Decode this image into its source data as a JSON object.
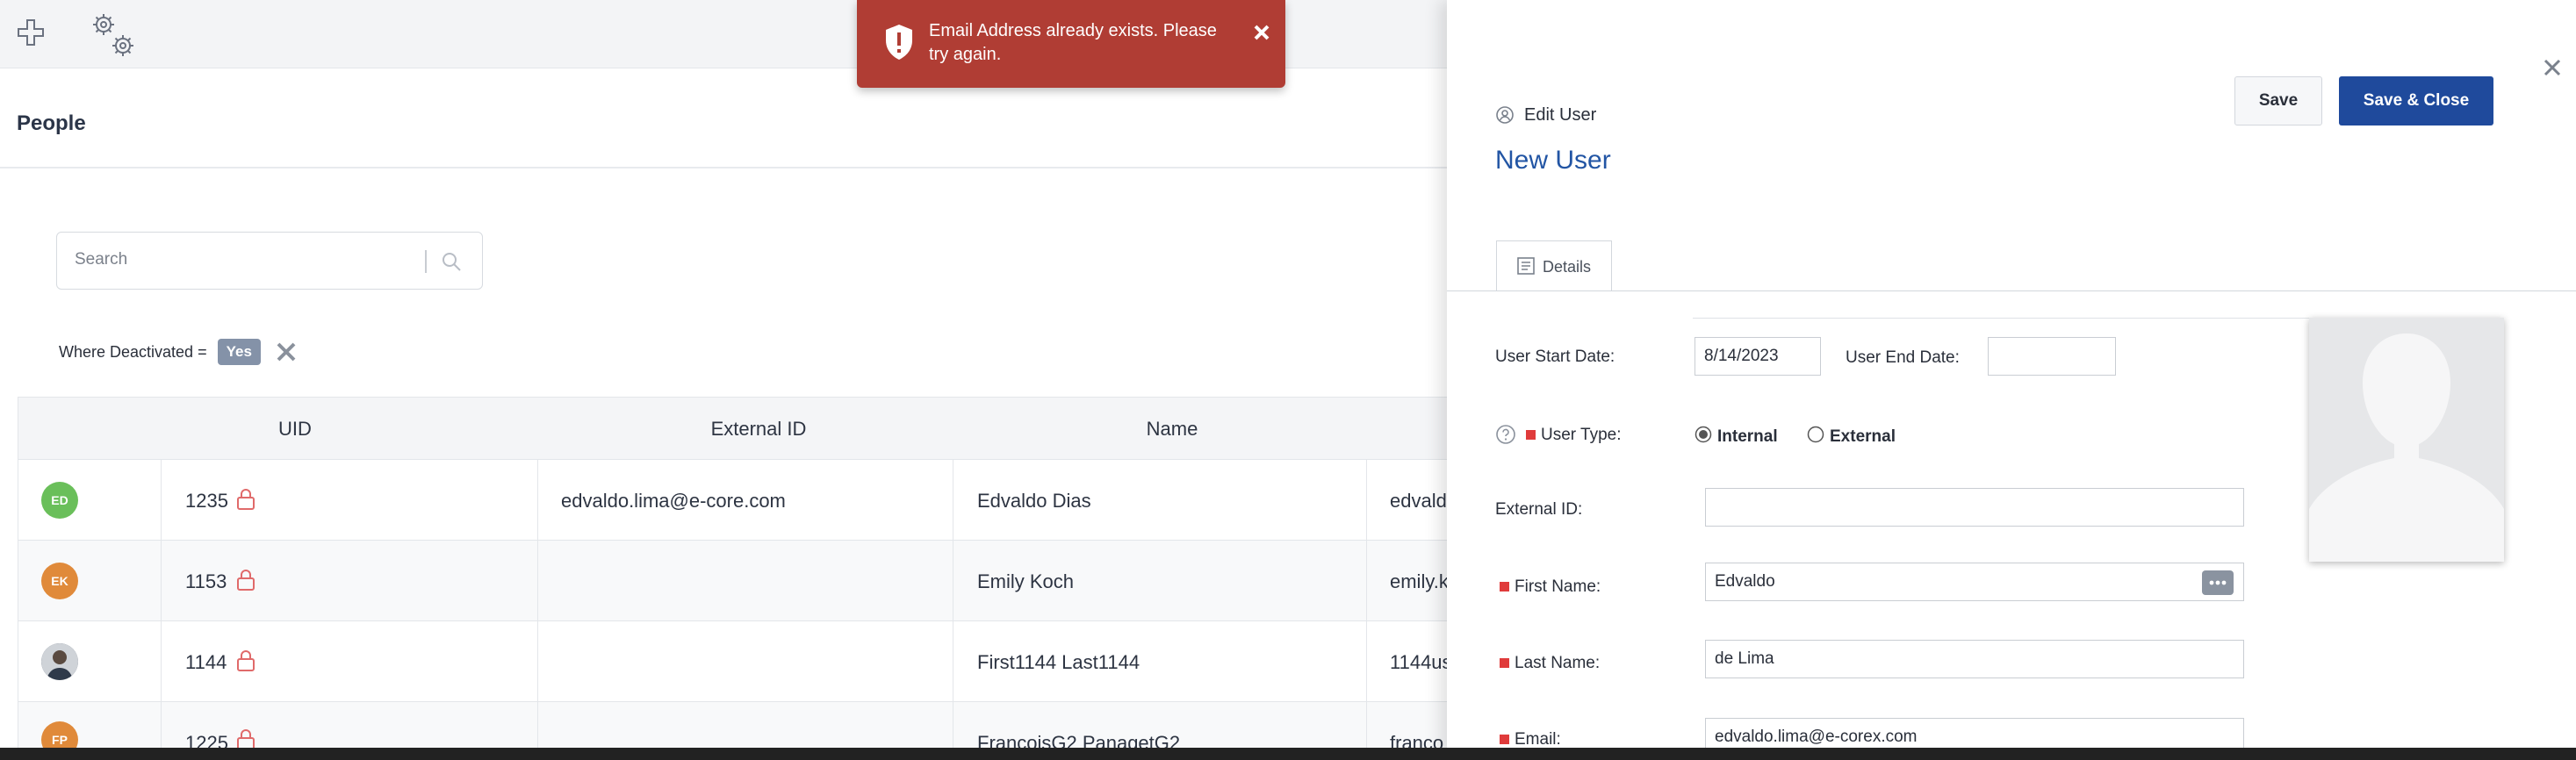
{
  "app": {
    "page_title": "People"
  },
  "search": {
    "placeholder": "Search"
  },
  "filter": {
    "label": "Where Deactivated =",
    "value": "Yes"
  },
  "table": {
    "columns": [
      "UID",
      "External ID",
      "Name"
    ],
    "rows": [
      {
        "initials": "ED",
        "avatar_color": "#6abf5a",
        "uid": "1235",
        "external_id": "edvaldo.lima@e-core.com",
        "name": "Edvaldo Dias",
        "extra": "edvald"
      },
      {
        "initials": "EK",
        "avatar_color": "#e08a3a",
        "uid": "1153",
        "external_id": "",
        "name": "Emily Koch",
        "extra": "emily.k"
      },
      {
        "initials": "",
        "avatar_color": "#4a5568",
        "uid": "1144",
        "external_id": "",
        "name": "First1144 Last1144",
        "extra": "1144us"
      },
      {
        "initials": "FP",
        "avatar_color": "#e08a3a",
        "uid": "1225",
        "external_id": "",
        "name": "FrancoisG2 PanagetG2",
        "extra": "franco"
      }
    ]
  },
  "toast": {
    "message": "Email Address already exists. Please try again."
  },
  "panel": {
    "header_label": "Edit User",
    "title": "New User",
    "save_label": "Save",
    "save_close_label": "Save & Close",
    "tab_details": "Details",
    "fields": {
      "start_date_label": "User Start Date:",
      "start_date_value": "8/14/2023",
      "end_date_label": "User End Date:",
      "end_date_value": "",
      "user_type_label": "User Type:",
      "user_type_internal": "Internal",
      "user_type_external": "External",
      "user_type_selected": "Internal",
      "external_id_label": "External ID:",
      "external_id_value": "",
      "first_name_label": "First Name:",
      "first_name_value": "Edvaldo",
      "last_name_label": "Last Name:",
      "last_name_value": "de Lima",
      "email_label": "Email:",
      "email_value": "edvaldo.lima@e-corex.com"
    }
  },
  "colors": {
    "primary": "#1f4a9c",
    "toast": "#b03d34",
    "required": "#e03b3b",
    "title": "#2255a4"
  }
}
